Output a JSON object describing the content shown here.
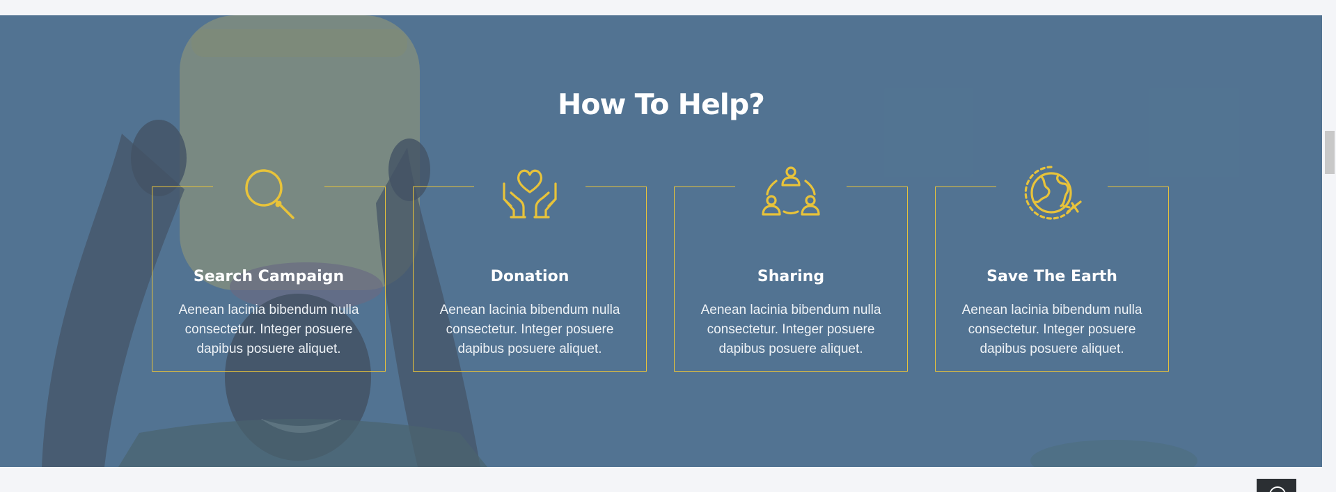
{
  "section": {
    "title": "How To Help?"
  },
  "cards": [
    {
      "icon": "search-icon",
      "title": "Search Campaign",
      "text": "Aenean lacinia bibendum nulla consectetur. Integer posuere dapibus posuere aliquet."
    },
    {
      "icon": "heart-hands-icon",
      "title": "Donation",
      "text": "Aenean lacinia bibendum nulla consectetur. Integer posuere dapibus posuere aliquet."
    },
    {
      "icon": "people-network-icon",
      "title": "Sharing",
      "text": "Aenean lacinia bibendum nulla consectetur. Integer posuere dapibus posuere aliquet."
    },
    {
      "icon": "globe-plane-icon",
      "title": "Save The Earth",
      "text": "Aenean lacinia bibendum nulla consectetur. Integer posuere dapibus posuere aliquet."
    }
  ],
  "colors": {
    "accent": "#e8c33a",
    "overlay": "#587a97",
    "text": "#ffffff",
    "page_background": "#f4f5f8"
  }
}
